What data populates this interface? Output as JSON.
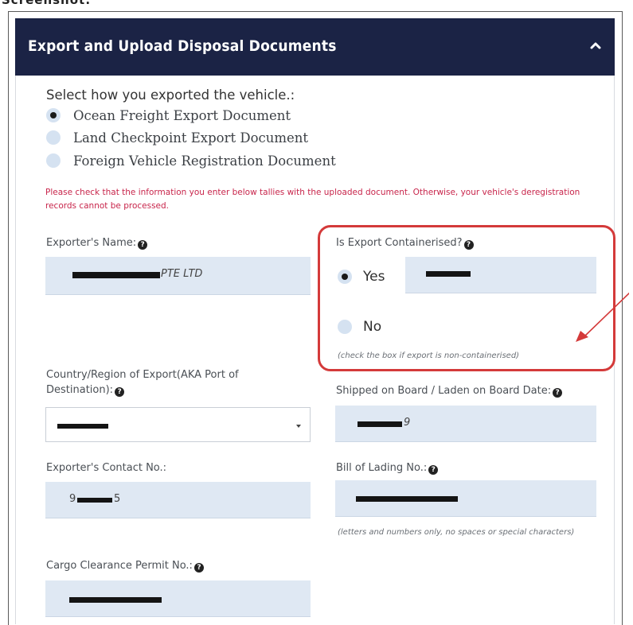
{
  "top_text": "Screenshot:",
  "panel": {
    "title": "Export and Upload Disposal Documents",
    "collapse_icon": "chevron-up-icon"
  },
  "export_method": {
    "question": "Select how you exported the vehicle.:",
    "options": [
      {
        "label": "Ocean Freight Export Document",
        "checked": true
      },
      {
        "label": "Land Checkpoint Export Document",
        "checked": false
      },
      {
        "label": "Foreign Vehicle Registration Document",
        "checked": false
      }
    ]
  },
  "warning": "Please check that the information you enter below tallies with the uploaded document. Otherwise, your vehicle's deregistration records cannot be processed.",
  "fields": {
    "exporter_name": {
      "label": "Exporter's Name:",
      "value_suffix": "PTE LTD"
    },
    "containerised": {
      "label": "Is Export Containerised?",
      "yes_label": "Yes",
      "no_label": "No",
      "selected": "Yes",
      "hint": "(check the box if export is non-containerised)"
    },
    "country": {
      "label": "Country/Region of Export(AKA Port of Destination):"
    },
    "shipped_date": {
      "label": "Shipped on Board / Laden on Board Date:",
      "value_suffix": "9"
    },
    "contact": {
      "label": "Exporter's Contact No.:",
      "value_prefix": "9",
      "value_suffix": "5"
    },
    "bill_of_lading": {
      "label": "Bill of Lading No.:",
      "hint": "(letters and numbers only, no spaces or special characters)"
    },
    "ccp": {
      "label": "Cargo Clearance Permit No.:"
    }
  },
  "colors": {
    "header_bg": "#1b2345",
    "input_bg": "#dfe8f3",
    "warning": "#c8254b",
    "annotation": "#d43a3a"
  }
}
